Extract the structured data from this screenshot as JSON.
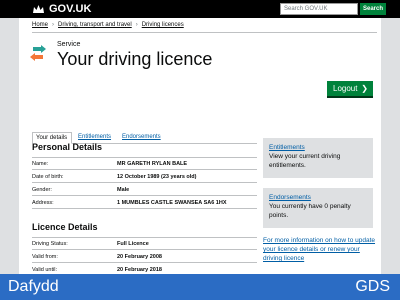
{
  "header": {
    "logotype": "GOV.UK",
    "search_placeholder": "Search GOV.UK",
    "search_button": "Search",
    "crown_icon": "crown-icon"
  },
  "breadcrumbs": [
    "Home",
    "Driving, transport and travel",
    "Driving licences"
  ],
  "service": {
    "label": "Service",
    "title": "Your driving licence",
    "icon": "licence-arrows-icon"
  },
  "logout": {
    "label": "Logout",
    "arrow": "❯"
  },
  "tabs": [
    {
      "label": "Your details",
      "active": true
    },
    {
      "label": "Entitlements",
      "active": false
    },
    {
      "label": "Endorsements",
      "active": false
    }
  ],
  "personal_details": {
    "heading": "Personal Details",
    "rows": [
      {
        "label": "Name:",
        "value": "MR GARETH RYLAN BALE"
      },
      {
        "label": "Date of birth:",
        "value": "12 October 1989 (23 years old)"
      },
      {
        "label": "Gender:",
        "value": "Male"
      },
      {
        "label": "Address:",
        "value": "1 MUMBLES CASTLE SWANSEA SA6 1HX"
      }
    ]
  },
  "licence_details": {
    "heading": "Licence Details",
    "rows": [
      {
        "label": "Driving Status:",
        "value": "Full Licence"
      },
      {
        "label": "Valid from:",
        "value": "20 February 2008"
      },
      {
        "label": "Valid until:",
        "value": "20 February 2018"
      }
    ]
  },
  "sidebar": {
    "entitlements": {
      "title": "Entitlements",
      "text": "View your current driving entitlements."
    },
    "endorsements": {
      "title": "Endorsements",
      "text": "You currently have 0 penalty points."
    },
    "more_info": "For more information on how to update your licence details or renew your driving licence"
  },
  "caption": {
    "left": "Dafydd",
    "right": "GDS"
  },
  "colors": {
    "header_bg": "#000000",
    "button_green": "#00823b",
    "link_blue": "#005ea5",
    "caption_blue": "#2b6cc4",
    "icon_teal": "#28a197",
    "icon_orange": "#f47738"
  }
}
